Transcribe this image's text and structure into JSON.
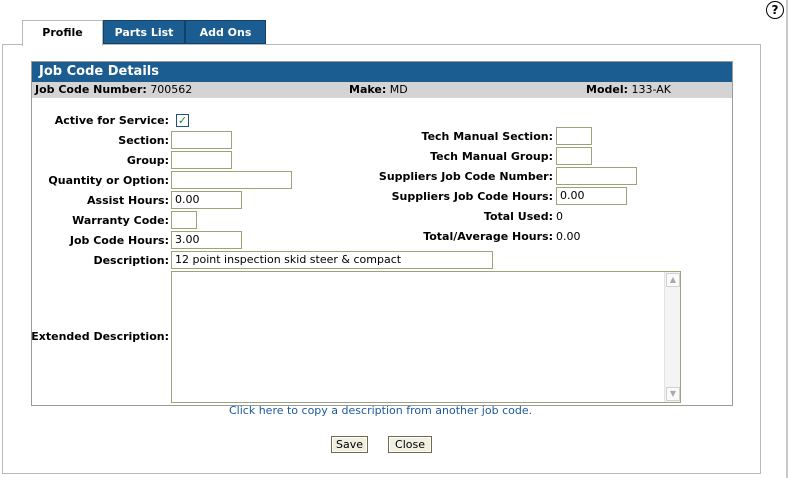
{
  "help_icon": "?",
  "tabs": [
    {
      "label": "Profile",
      "active": true
    },
    {
      "label": "Parts List",
      "active": false
    },
    {
      "label": "Add Ons",
      "active": false
    }
  ],
  "section": {
    "title": "Job Code Details",
    "job_code_number_label": "Job Code Number:",
    "job_code_number": "700562",
    "make_label": "Make:",
    "make": "MD",
    "model_label": "Model:",
    "model": "133-AK"
  },
  "form": {
    "active_for_service": {
      "label": "Active for Service:",
      "checked": true,
      "glyph": "✓"
    },
    "section": {
      "label": "Section:",
      "value": ""
    },
    "group": {
      "label": "Group:",
      "value": ""
    },
    "quantity_or_option": {
      "label": "Quantity or Option:",
      "value": ""
    },
    "assist_hours": {
      "label": "Assist Hours:",
      "value": "0.00"
    },
    "warranty_code": {
      "label": "Warranty Code:",
      "value": ""
    },
    "job_code_hours": {
      "label": "Job Code Hours:",
      "value": "3.00"
    },
    "description": {
      "label": "Description:",
      "value": "12 point inspection skid steer & compact"
    },
    "extended_description": {
      "label": "Extended Description:",
      "value": ""
    },
    "tech_manual_section": {
      "label": "Tech Manual Section:",
      "value": ""
    },
    "tech_manual_group": {
      "label": "Tech Manual Group:",
      "value": ""
    },
    "suppliers_job_code_number": {
      "label": "Suppliers Job Code Number:",
      "value": ""
    },
    "suppliers_job_code_hours": {
      "label": "Suppliers Job Code Hours:",
      "value": "0.00"
    },
    "total_used": {
      "label": "Total Used:",
      "value": "0"
    },
    "total_average_hours": {
      "label": "Total/Average Hours:",
      "value": "0.00"
    }
  },
  "copy_link": "Click here to copy a description from another job code.",
  "buttons": {
    "save": "Save",
    "close": "Close"
  },
  "colors": {
    "header_blue": "#1b5c91",
    "info_bar": "#d4d4d4",
    "link": "#1a5a9a",
    "check": "#2a8a2a"
  }
}
